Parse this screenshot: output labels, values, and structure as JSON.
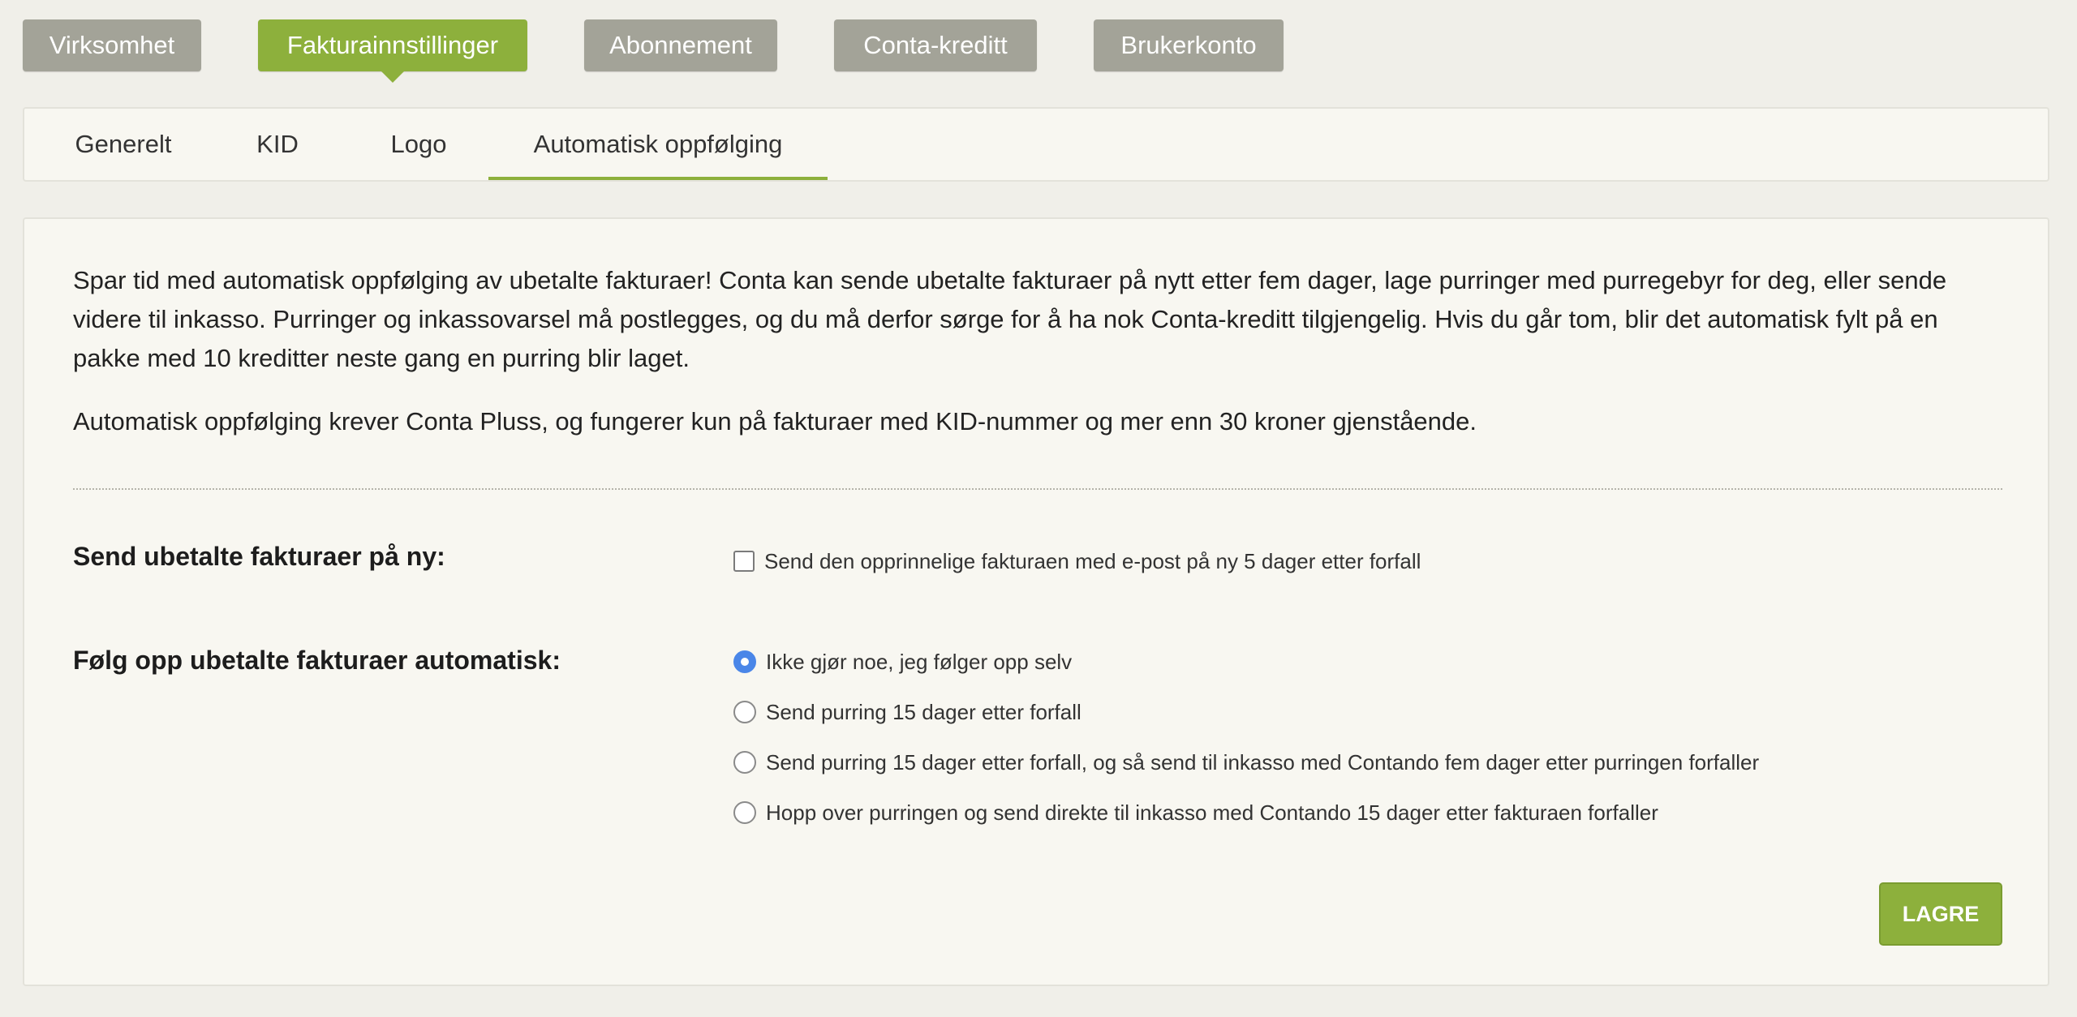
{
  "top_tabs": [
    {
      "label": "Virksomhet"
    },
    {
      "label": "Fakturainnstillinger"
    },
    {
      "label": "Abonnement"
    },
    {
      "label": "Conta-kreditt"
    },
    {
      "label": "Brukerkonto"
    }
  ],
  "active_top_tab": "Fakturainnstillinger",
  "sub_tabs": [
    {
      "label": "Generelt"
    },
    {
      "label": "KID"
    },
    {
      "label": "Logo"
    },
    {
      "label": "Automatisk oppfølging"
    }
  ],
  "active_sub_tab": "Automatisk oppfølging",
  "intro_text": "Spar tid med automatisk oppfølging av ubetalte fakturaer! Conta kan sende ubetalte fakturaer på nytt etter fem dager, lage purringer med purregebyr for deg, eller sende videre til inkasso. Purringer og inkassovarsel må postlegges, og du må derfor sørge for å ha nok Conta-kreditt tilgjengelig. Hvis du går tom, blir det automatisk fylt på en pakke med 10 kreditter neste gang en purring blir laget.",
  "requirement_text": "Automatisk oppfølging krever Conta Pluss, og fungerer kun på fakturaer med KID-nummer og mer enn 30 kroner gjenstående.",
  "resend": {
    "label": "Send ubetalte fakturaer på ny:",
    "checkbox_label": "Send den opprinnelige fakturaen med e-post på ny 5 dager etter forfall",
    "checked": false
  },
  "followup": {
    "label": "Følg opp ubetalte fakturaer automatisk:",
    "options": [
      {
        "label": "Ikke gjør noe, jeg følger opp selv",
        "selected": true
      },
      {
        "label": "Send purring 15 dager etter forfall",
        "selected": false
      },
      {
        "label": "Send purring 15 dager etter forfall, og så send til inkasso med Contando fem dager etter purringen forfaller",
        "selected": false
      },
      {
        "label": "Hopp over purringen og send direkte til inkasso med Contando 15 dager etter fakturaen forfaller",
        "selected": false
      }
    ]
  },
  "save_label": "LAGRE",
  "colors": {
    "accent": "#8db03c",
    "tab_inactive": "#a3a398",
    "radio_selected": "#4a86e8",
    "background": "#f0efe9",
    "panel": "#f8f7f1"
  }
}
